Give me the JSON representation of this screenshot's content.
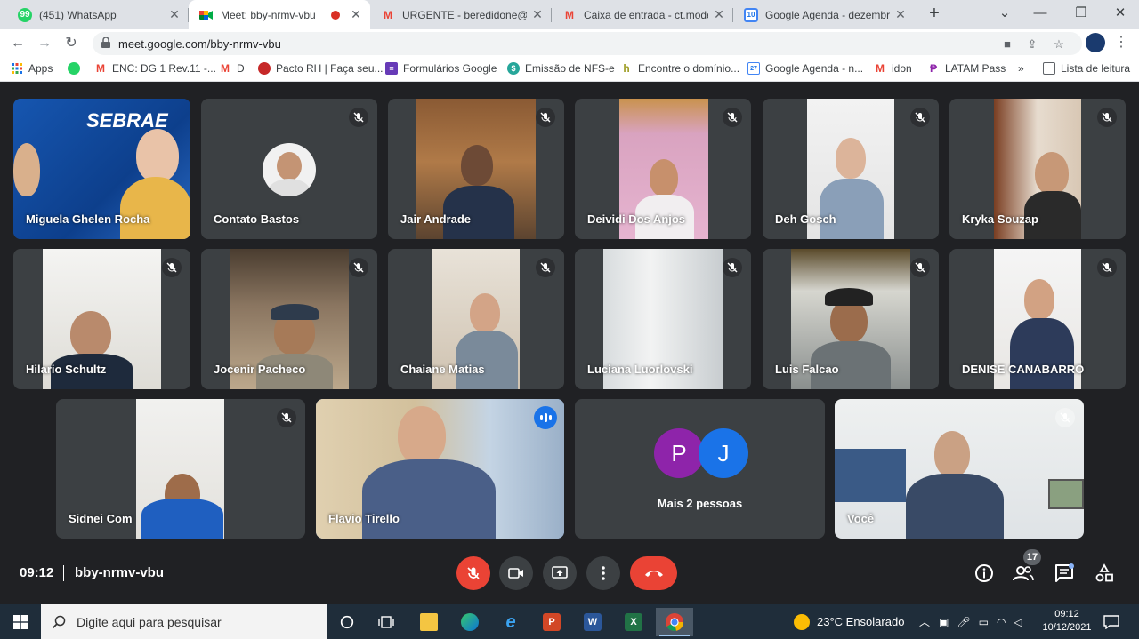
{
  "browser": {
    "tabs": [
      {
        "title": "(451) WhatsApp",
        "favicon": "whatsapp-icon",
        "active": false
      },
      {
        "title": "Meet: bby-nrmv-vbu",
        "favicon": "google-meet-icon",
        "active": true
      },
      {
        "title": "URGENTE - beredidone@gm",
        "favicon": "gmail-icon",
        "active": false
      },
      {
        "title": "Caixa de entrada - ct.modela",
        "favicon": "gmail-icon",
        "active": false
      },
      {
        "title": "Google Agenda - dezembro",
        "favicon": "google-calendar-icon",
        "active": false
      }
    ],
    "url": "meet.google.com/bby-nrmv-vbu",
    "bookmarks": [
      "Apps",
      "",
      "ENC: DG 1 Rev.11 -...",
      "D",
      "Pacto RH | Faça seu...",
      "Formulários Google",
      "Emissão de NFS-e",
      "Encontre o domínio...",
      "Google Agenda - n...",
      "idon",
      "LATAM Pass",
      "»",
      "Lista de leitura"
    ]
  },
  "meet": {
    "participants": [
      {
        "name": "Miguela Ghelen Rocha",
        "muted": false
      },
      {
        "name": "Contato Bastos",
        "muted": true
      },
      {
        "name": "Jair Andrade",
        "muted": true
      },
      {
        "name": "Deividi Dos Anjos",
        "muted": true
      },
      {
        "name": "Deh Gosch",
        "muted": true
      },
      {
        "name": "Kryka Souzap",
        "muted": true
      },
      {
        "name": "Hilario Schultz",
        "muted": true
      },
      {
        "name": "Jocenir Pacheco",
        "muted": true
      },
      {
        "name": "Chaiane Matias",
        "muted": true
      },
      {
        "name": "Luciana Luorlovski",
        "muted": true
      },
      {
        "name": "Luis Falcao",
        "muted": true
      },
      {
        "name": "DENISE CANABARRO",
        "muted": true
      },
      {
        "name": "Sidnei Com",
        "muted": true
      },
      {
        "name": "Flavio Tirello",
        "muted": false,
        "speaking": true
      },
      {
        "name": "Você",
        "muted": true
      }
    ],
    "more": {
      "label": "Mais 2 pessoas",
      "initials": [
        "P",
        "J"
      ],
      "colors": [
        "#8e24aa",
        "#1a73e8"
      ]
    },
    "sign_text": "SEBRAE",
    "time": "09:12",
    "meeting_code": "bby-nrmv-vbu",
    "participant_count": "17",
    "accent": "#8ab4f8",
    "hangup_color": "#ea4335"
  },
  "taskbar": {
    "search_placeholder": "Digite aqui para pesquisar",
    "weather": "23°C  Ensolarado",
    "time": "09:12",
    "date": "10/12/2021"
  }
}
